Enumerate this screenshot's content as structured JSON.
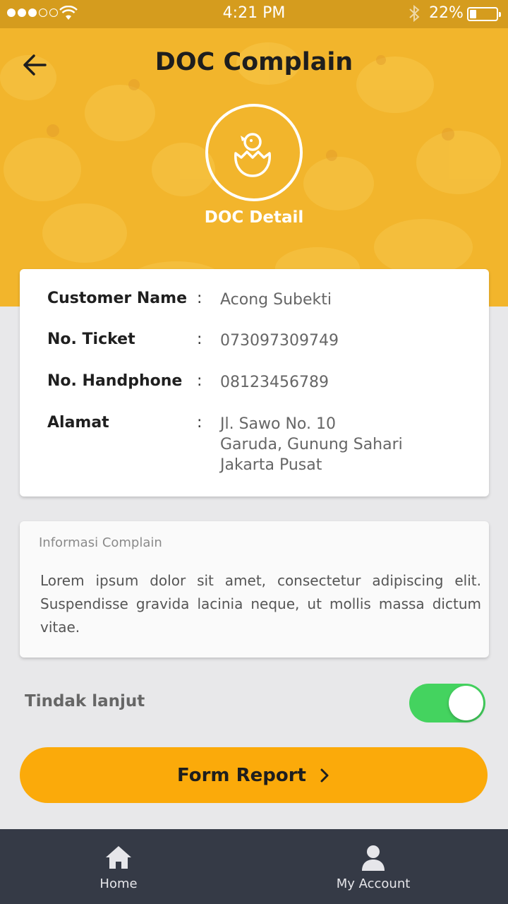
{
  "status_bar": {
    "time": "4:21 PM",
    "battery": "22%",
    "battery_level": 0.22,
    "icons": [
      "signal-icon",
      "wifi-icon",
      "bluetooth-icon",
      "battery-icon"
    ]
  },
  "header": {
    "title": "DOC Complain",
    "back_icon": "arrow-left-icon",
    "hero_icon": "hatching-chick-icon",
    "hero_label": "DOC Detail"
  },
  "details": [
    {
      "label": "Customer Name",
      "separator": ":",
      "value": "Acong Subekti"
    },
    {
      "label": "No. Ticket",
      "separator": ":",
      "value": "073097309749"
    },
    {
      "label": "No. Handphone",
      "separator": ":",
      "value": "08123456789"
    },
    {
      "label": "Alamat",
      "separator": ":",
      "value_lines": [
        "Jl. Sawo No. 10",
        "Garuda, Gunung Sahari",
        "Jakarta Pusat"
      ]
    }
  ],
  "info": {
    "title": "Informasi Complain",
    "text": "Lorem ipsum dolor sit amet, consectetur adipiscing elit. Suspendisse gravida lacinia neque, ut mollis massa dictum vitae."
  },
  "tindak": {
    "label": "Tindak lanjut",
    "on": true
  },
  "form_button": {
    "label": "Form Report",
    "icon": "chevron-right-icon"
  },
  "nav": {
    "home": {
      "label": "Home",
      "icon": "home-icon"
    },
    "account": {
      "label": "My Account",
      "icon": "user-icon"
    }
  },
  "colors": {
    "hero": "#f2b52c",
    "accent": "#fbaa0a",
    "toggle_on": "#44d35f",
    "nav_bg": "#353a46",
    "page_bg": "#e8e8ea"
  }
}
